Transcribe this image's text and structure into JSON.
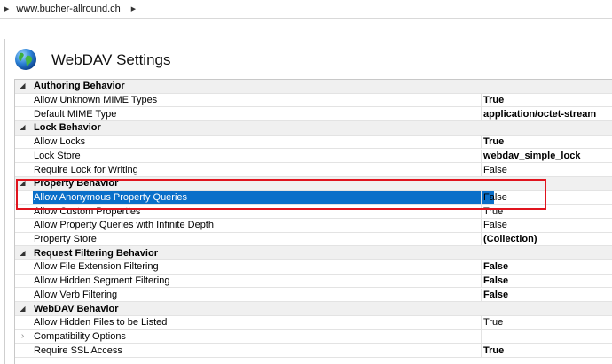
{
  "breadcrumb": {
    "item": "www.bucher-allround.ch"
  },
  "page": {
    "title": "WebDAV Settings"
  },
  "colors": {
    "selection": "#0a6fc9",
    "annotation": "#e0141e",
    "category_bg": "#f0f0f0"
  },
  "icons": {
    "page_icon": "webdav-globe-icon"
  },
  "grid": {
    "rows": [
      {
        "type": "category",
        "name": "Authoring Behavior"
      },
      {
        "type": "property",
        "name": "Allow Unknown MIME Types",
        "value": "True",
        "bold": true
      },
      {
        "type": "property",
        "name": "Default MIME Type",
        "value": "application/octet-stream",
        "bold": true
      },
      {
        "type": "category",
        "name": "Lock Behavior"
      },
      {
        "type": "property",
        "name": "Allow Locks",
        "value": "True",
        "bold": true
      },
      {
        "type": "property",
        "name": "Lock Store",
        "value": "webdav_simple_lock",
        "bold": true
      },
      {
        "type": "property",
        "name": "Require Lock for Writing",
        "value": "False",
        "bold": false
      },
      {
        "type": "category",
        "name": "Property Behavior"
      },
      {
        "type": "property",
        "name": "Allow Anonymous Property Queries",
        "value": "False",
        "bold": false,
        "selected": true
      },
      {
        "type": "property",
        "name": "Allow Custom Properties",
        "value": "True",
        "bold": false
      },
      {
        "type": "property",
        "name": "Allow Property Queries with Infinite Depth",
        "value": "False",
        "bold": false
      },
      {
        "type": "property",
        "name": "Property Store",
        "value": "(Collection)",
        "bold": true
      },
      {
        "type": "category",
        "name": "Request Filtering Behavior"
      },
      {
        "type": "property",
        "name": "Allow File Extension Filtering",
        "value": "False",
        "bold": true
      },
      {
        "type": "property",
        "name": "Allow Hidden Segment Filtering",
        "value": "False",
        "bold": true
      },
      {
        "type": "property",
        "name": "Allow Verb Filtering",
        "value": "False",
        "bold": true
      },
      {
        "type": "category",
        "name": "WebDAV Behavior"
      },
      {
        "type": "property",
        "name": "Allow Hidden Files to be Listed",
        "value": "True",
        "bold": false
      },
      {
        "type": "property",
        "name": "Compatibility Options",
        "value": "",
        "bold": false,
        "expandable": true
      },
      {
        "type": "property",
        "name": "Require SSL Access",
        "value": "True",
        "bold": true
      }
    ]
  }
}
